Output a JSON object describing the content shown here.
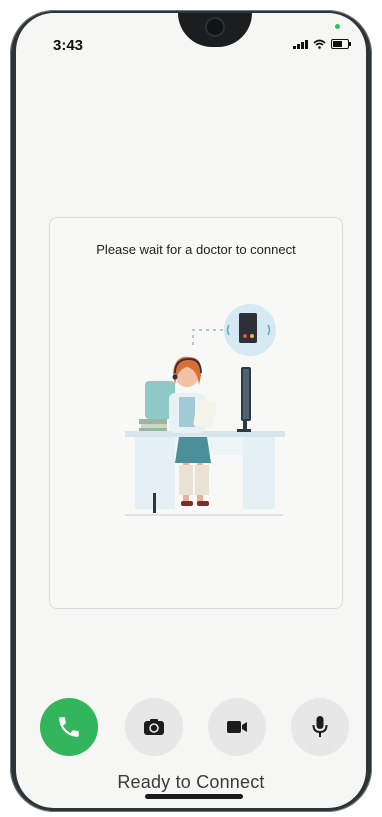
{
  "status_bar": {
    "time": "3:43",
    "icons": [
      "signal-icon",
      "wifi-icon",
      "battery-icon"
    ]
  },
  "waiting_card": {
    "message": "Please wait for a doctor to connect",
    "illustration": "doctor-at-desk-with-headset-illustration"
  },
  "controls": {
    "call_icon": "phone-icon",
    "flip_icon": "camera-switch-icon",
    "video_icon": "video-camera-icon",
    "mic_icon": "microphone-icon"
  },
  "footer": {
    "status": "Ready to Connect"
  },
  "colors": {
    "call_button": "#32b55b",
    "secondary_button": "#e7e7e7",
    "accent_light_blue": "#cfe7ef"
  }
}
